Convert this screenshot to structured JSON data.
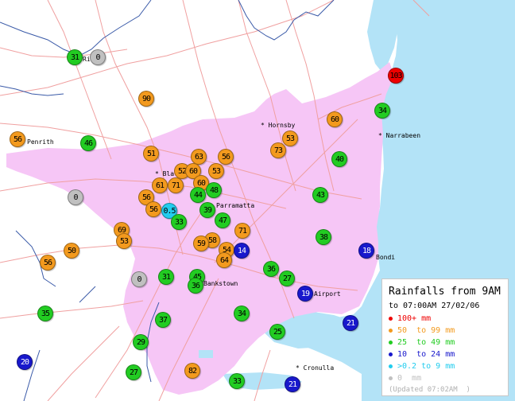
{
  "map": {
    "colors": {
      "sea": "#b3e3f7",
      "urban": "#f6c6f6",
      "land": "#ffffff",
      "road": "#f0a0a0",
      "border": "#3a5aa8"
    },
    "places": [
      {
        "name": "Hornsby",
        "prefix": "*"
      },
      {
        "name": "Narrabeen",
        "prefix": "*"
      },
      {
        "name": "Penrith",
        "prefix": ""
      },
      {
        "name": "Bla",
        "prefix": "*"
      },
      {
        "name": "Parramatta",
        "prefix": ""
      },
      {
        "name": "Bondi",
        "prefix": ""
      },
      {
        "name": "Bankstown",
        "prefix": ""
      },
      {
        "name": "Airport",
        "prefix": ""
      },
      {
        "name": "Cronulla",
        "prefix": "*"
      },
      {
        "name": "Ri   nd",
        "prefix": ""
      }
    ],
    "gauges": [
      {
        "value": "31",
        "category": "25to49"
      },
      {
        "value": "0",
        "category": "zero"
      },
      {
        "value": "103",
        "category": "100plus"
      },
      {
        "value": "90",
        "category": "50to99"
      },
      {
        "value": "34",
        "category": "25to49"
      },
      {
        "value": "60",
        "category": "50to99"
      },
      {
        "value": "56",
        "category": "50to99"
      },
      {
        "value": "46",
        "category": "25to49"
      },
      {
        "value": "53",
        "category": "50to99"
      },
      {
        "value": "73",
        "category": "50to99"
      },
      {
        "value": "51",
        "category": "50to99"
      },
      {
        "value": "63",
        "category": "50to99"
      },
      {
        "value": "56",
        "category": "50to99"
      },
      {
        "value": "40",
        "category": "25to49"
      },
      {
        "value": "52",
        "category": "50to99"
      },
      {
        "value": "60",
        "category": "50to99"
      },
      {
        "value": "53",
        "category": "50to99"
      },
      {
        "value": "61",
        "category": "50to99"
      },
      {
        "value": "71",
        "category": "50to99"
      },
      {
        "value": "60",
        "category": "50to99"
      },
      {
        "value": "0",
        "category": "zero"
      },
      {
        "value": "48",
        "category": "25to49"
      },
      {
        "value": "44",
        "category": "25to49"
      },
      {
        "value": "56",
        "category": "50to99"
      },
      {
        "value": "43",
        "category": "25to49"
      },
      {
        "value": "56",
        "category": "50to99"
      },
      {
        "value": "0.5",
        "category": "small"
      },
      {
        "value": "39",
        "category": "25to49"
      },
      {
        "value": "33",
        "category": "25to49"
      },
      {
        "value": "47",
        "category": "25to49"
      },
      {
        "value": "69",
        "category": "50to99"
      },
      {
        "value": "71",
        "category": "50to99"
      },
      {
        "value": "53",
        "category": "50to99"
      },
      {
        "value": "38",
        "category": "25to49"
      },
      {
        "value": "58",
        "category": "50to99"
      },
      {
        "value": "59",
        "category": "50to99"
      },
      {
        "value": "54",
        "category": "50to99"
      },
      {
        "value": "14",
        "category": "10to24"
      },
      {
        "value": "18",
        "category": "10to24"
      },
      {
        "value": "64",
        "category": "50to99"
      },
      {
        "value": "56",
        "category": "50to99"
      },
      {
        "value": "50",
        "category": "50to99"
      },
      {
        "value": "36",
        "category": "25to49"
      },
      {
        "value": "27",
        "category": "25to49"
      },
      {
        "value": "0",
        "category": "zero"
      },
      {
        "value": "31",
        "category": "25to49"
      },
      {
        "value": "45",
        "category": "25to49"
      },
      {
        "value": "36",
        "category": "25to49"
      },
      {
        "value": "19",
        "category": "10to24"
      },
      {
        "value": "35",
        "category": "25to49"
      },
      {
        "value": "34",
        "category": "25to49"
      },
      {
        "value": "37",
        "category": "25to49"
      },
      {
        "value": "21",
        "category": "10to24"
      },
      {
        "value": "25",
        "category": "25to49"
      },
      {
        "value": "29",
        "category": "25to49"
      },
      {
        "value": "20",
        "category": "10to24"
      },
      {
        "value": "27",
        "category": "25to49"
      },
      {
        "value": "82",
        "category": "50to99"
      },
      {
        "value": "33",
        "category": "25to49"
      },
      {
        "value": "21",
        "category": "10to24"
      }
    ]
  },
  "legend": {
    "title": "Rainfalls from 9AM",
    "subtitle": "to 07:00AM 27/02/06",
    "items": [
      {
        "label": "100+ mm",
        "color": "#ee0000",
        "category": "100plus"
      },
      {
        "label": "50  to 99 mm",
        "color": "#f39a1e",
        "category": "50to99"
      },
      {
        "label": "25  to 49 mm",
        "color": "#22cc22",
        "category": "25to49"
      },
      {
        "label": "10  to 24 mm",
        "color": "#1818cc",
        "category": "10to24"
      },
      {
        "label": ">0.2 to 9 mm",
        "color": "#22ccee",
        "category": "small"
      },
      {
        "label": "0  mm",
        "color": "#c0c0c0",
        "category": "zero"
      }
    ],
    "updated": "(Updated 07:02AM  )"
  }
}
